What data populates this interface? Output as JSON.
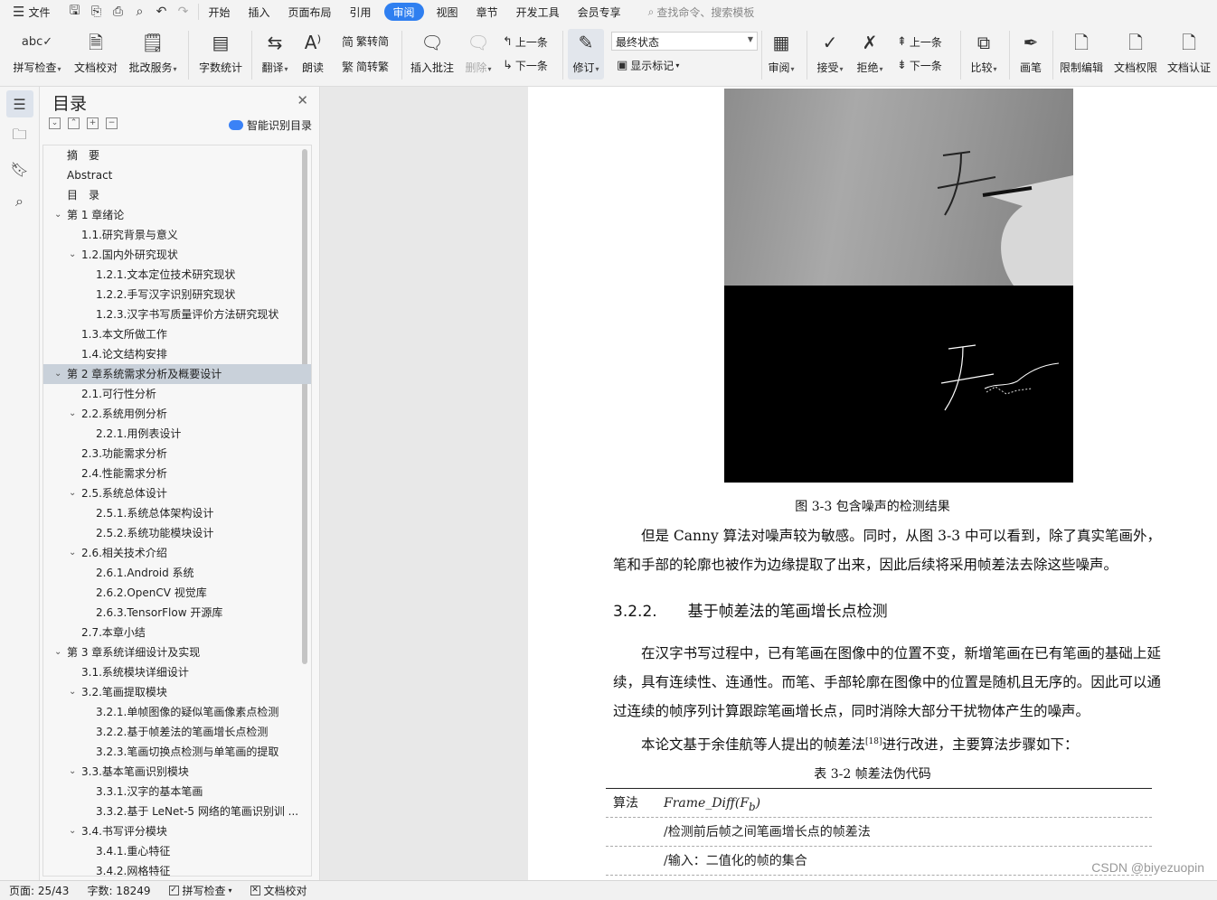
{
  "menubar": {
    "file_label": "文件",
    "tabs": [
      {
        "label": "开始",
        "active": false
      },
      {
        "label": "插入",
        "active": false
      },
      {
        "label": "页面布局",
        "active": false
      },
      {
        "label": "引用",
        "active": false
      },
      {
        "label": "审阅",
        "active": true
      },
      {
        "label": "视图",
        "active": false
      },
      {
        "label": "章节",
        "active": false
      },
      {
        "label": "开发工具",
        "active": false
      },
      {
        "label": "会员专享",
        "active": false
      }
    ],
    "search_placeholder": "查找命令、搜索模板"
  },
  "ribbon": {
    "spellcheck": "拼写检查",
    "doc_proof": "文档校对",
    "annotate_service": "批改服务",
    "word_count": "字数统计",
    "translate": "翻译",
    "read_aloud": "朗读",
    "trad_to_simp": "繁转简",
    "simp_to_trad": "简转繁",
    "insert_comment": "插入批注",
    "delete": "删除",
    "prev_comment": "上一条",
    "next_comment": "下一条",
    "track_changes": "修订",
    "display_state": "最终状态",
    "show_markup": "显示标记",
    "review": "审阅",
    "accept": "接受",
    "reject": "拒绝",
    "prev_change": "上一条",
    "next_change": "下一条",
    "compare": "比较",
    "ink": "画笔",
    "restrict_edit": "限制编辑",
    "doc_permission": "文档权限",
    "doc_certify": "文档认证"
  },
  "toc": {
    "title": "目录",
    "smart_label": "智能识别目录",
    "items": [
      {
        "text": "摘　要",
        "level": 0,
        "toggle": ""
      },
      {
        "text": "Abstract",
        "level": 0,
        "toggle": ""
      },
      {
        "text": "目　录",
        "level": 0,
        "toggle": ""
      },
      {
        "text": "第 1 章绪论",
        "level": 0,
        "toggle": "v"
      },
      {
        "text": "1.1.研究背景与意义",
        "level": 1,
        "toggle": ""
      },
      {
        "text": "1.2.国内外研究现状",
        "level": 1,
        "toggle": "v"
      },
      {
        "text": "1.2.1.文本定位技术研究现状",
        "level": 2,
        "toggle": ""
      },
      {
        "text": "1.2.2.手写汉字识别研究现状",
        "level": 2,
        "toggle": ""
      },
      {
        "text": "1.2.3.汉字书写质量评价方法研究现状",
        "level": 2,
        "toggle": ""
      },
      {
        "text": "1.3.本文所做工作",
        "level": 1,
        "toggle": ""
      },
      {
        "text": "1.4.论文结构安排",
        "level": 1,
        "toggle": ""
      },
      {
        "text": "第 2 章系统需求分析及概要设计",
        "level": 0,
        "toggle": "v",
        "selected": true
      },
      {
        "text": "2.1.可行性分析",
        "level": 1,
        "toggle": ""
      },
      {
        "text": "2.2.系统用例分析",
        "level": 1,
        "toggle": "v"
      },
      {
        "text": "2.2.1.用例表设计",
        "level": 2,
        "toggle": ""
      },
      {
        "text": "2.3.功能需求分析",
        "level": 1,
        "toggle": ""
      },
      {
        "text": "2.4.性能需求分析",
        "level": 1,
        "toggle": ""
      },
      {
        "text": "2.5.系统总体设计",
        "level": 1,
        "toggle": "v"
      },
      {
        "text": "2.5.1.系统总体架构设计",
        "level": 2,
        "toggle": ""
      },
      {
        "text": "2.5.2.系统功能模块设计",
        "level": 2,
        "toggle": ""
      },
      {
        "text": "2.6.相关技术介绍",
        "level": 1,
        "toggle": "v"
      },
      {
        "text": "2.6.1.Android 系统",
        "level": 2,
        "toggle": ""
      },
      {
        "text": "2.6.2.OpenCV 视觉库",
        "level": 2,
        "toggle": ""
      },
      {
        "text": "2.6.3.TensorFlow 开源库",
        "level": 2,
        "toggle": ""
      },
      {
        "text": "2.7.本章小结",
        "level": 1,
        "toggle": ""
      },
      {
        "text": "第 3 章系统详细设计及实现",
        "level": 0,
        "toggle": "v"
      },
      {
        "text": "3.1.系统模块详细设计",
        "level": 1,
        "toggle": ""
      },
      {
        "text": "3.2.笔画提取模块",
        "level": 1,
        "toggle": "v"
      },
      {
        "text": "3.2.1.单帧图像的疑似笔画像素点检测",
        "level": 2,
        "toggle": ""
      },
      {
        "text": "3.2.2.基于帧差法的笔画增长点检测",
        "level": 2,
        "toggle": ""
      },
      {
        "text": "3.2.3.笔画切换点检测与单笔画的提取",
        "level": 2,
        "toggle": ""
      },
      {
        "text": "3.3.基本笔画识别模块",
        "level": 1,
        "toggle": "v"
      },
      {
        "text": "3.3.1.汉字的基本笔画",
        "level": 2,
        "toggle": ""
      },
      {
        "text": "3.3.2.基于 LeNet-5 网络的笔画识别训 ...",
        "level": 2,
        "toggle": ""
      },
      {
        "text": "3.4.书写评分模块",
        "level": 1,
        "toggle": "v"
      },
      {
        "text": "3.4.1.重心特征",
        "level": 2,
        "toggle": ""
      },
      {
        "text": "3.4.2.网格特征",
        "level": 2,
        "toggle": ""
      }
    ]
  },
  "document": {
    "figure_caption": "图 3-3  包含噪声的检测结果",
    "para1": "但是 Canny 算法对噪声较为敏感。同时，从图 3-3 中可以看到，除了真实笔画外，笔和手部的轮廓也被作为边缘提取了出来，因此后续将采用帧差法去除这些噪声。",
    "heading_num": "3.2.2.",
    "heading_text": "基于帧差法的笔画增长点检测",
    "para2": "在汉字书写过程中，已有笔画在图像中的位置不变，新增笔画在已有笔画的基础上延续，具有连续性、连通性。而笔、手部轮廓在图像中的位置是随机且无序的。因此可以通过连续的帧序列计算跟踪笔画增长点，同时消除大部分干扰物体产生的噪声。",
    "para3_before": "本论文基于余佳航等人提出的帧差法",
    "para3_ref": "[18]",
    "para3_after": "进行改进，主要算法步骤如下：",
    "table_caption": "表 3-2  帧差法伪代码",
    "algo_label": "算法",
    "algo_name": "Frame_Diff(F",
    "algo_sub": "b",
    "algo_close": ")",
    "algo_line1": "/检测前后帧之间笔画增长点的帧差法",
    "algo_line2": "/输入：二值化的帧的集合"
  },
  "status": {
    "page": "页面: 25/43",
    "words": "字数: 18249",
    "spellcheck": "拼写检查",
    "proof": "文档校对"
  },
  "watermark": "CSDN @biyezuopin"
}
